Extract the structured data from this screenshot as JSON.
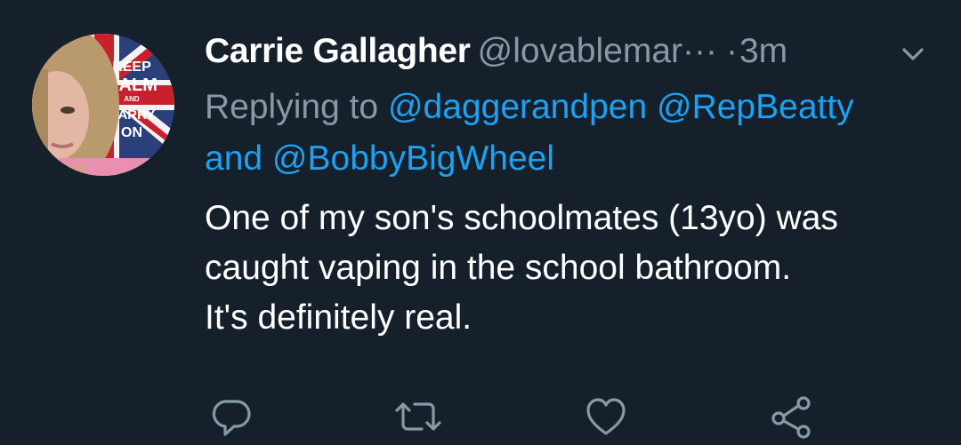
{
  "tweet": {
    "author": {
      "display_name": "Carrie Gallagher",
      "handle": "@lovablemar···",
      "avatar": {
        "poster_lines": [
          "KEEP",
          "CALM",
          "AND",
          "CARRY",
          "ON"
        ]
      }
    },
    "separator": "·",
    "timestamp": "3m",
    "menu_icon": "chevron-down-icon",
    "replying_to": {
      "prefix": "Replying to",
      "mentions": [
        "@daggerandpen",
        "@RepBeatty",
        "@BobbyBigWheel"
      ],
      "conjunction": "and"
    },
    "text_lines": [
      "One of my son's schoolmates (13yo) was",
      "caught vaping in the school bathroom.",
      "It's definitely real."
    ],
    "actions": [
      {
        "name": "reply",
        "icon": "reply-icon"
      },
      {
        "name": "retweet",
        "icon": "retweet-icon"
      },
      {
        "name": "like",
        "icon": "heart-icon"
      },
      {
        "name": "share",
        "icon": "share-icon"
      }
    ]
  },
  "colors": {
    "background": "#15202b",
    "primary_text": "#ffffff",
    "secondary_text": "#8899a6",
    "link": "#1da1f2"
  }
}
